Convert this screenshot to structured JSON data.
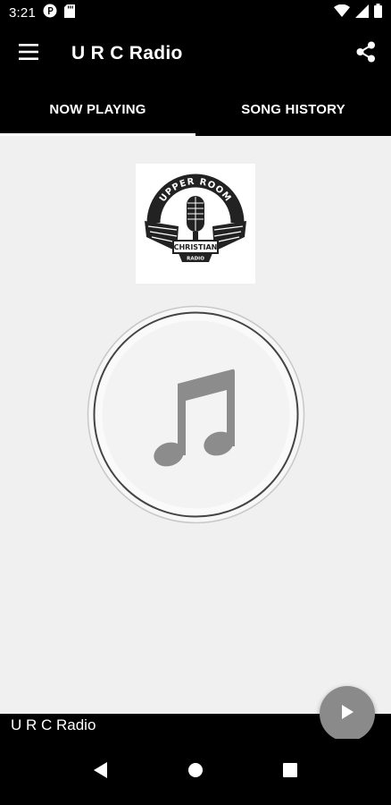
{
  "status_bar": {
    "time": "3:21",
    "icons": [
      "p-badge-icon",
      "sd-card-icon",
      "wifi-icon",
      "signal-icon",
      "battery-icon"
    ]
  },
  "app_bar": {
    "title": "U R C Radio",
    "menu_icon": "hamburger-menu-icon",
    "share_icon": "share-icon"
  },
  "tabs": [
    {
      "label": "NOW PLAYING",
      "active": true
    },
    {
      "label": "SONG HISTORY",
      "active": false
    }
  ],
  "station_logo": {
    "line1": "UPPER ROOM",
    "line2": "CHRISTIAN",
    "line3": "RADIO"
  },
  "album_art": {
    "icon": "music-note-icon"
  },
  "player": {
    "now_playing_title": "U R C Radio",
    "play_icon": "play-icon"
  },
  "nav_bar": {
    "icons": [
      "back-icon",
      "home-icon",
      "recents-icon"
    ]
  },
  "colors": {
    "background": "#000000",
    "content_background": "#f0f0f0",
    "fab": "#8a8a8a",
    "music_note": "#8c8c8c"
  }
}
